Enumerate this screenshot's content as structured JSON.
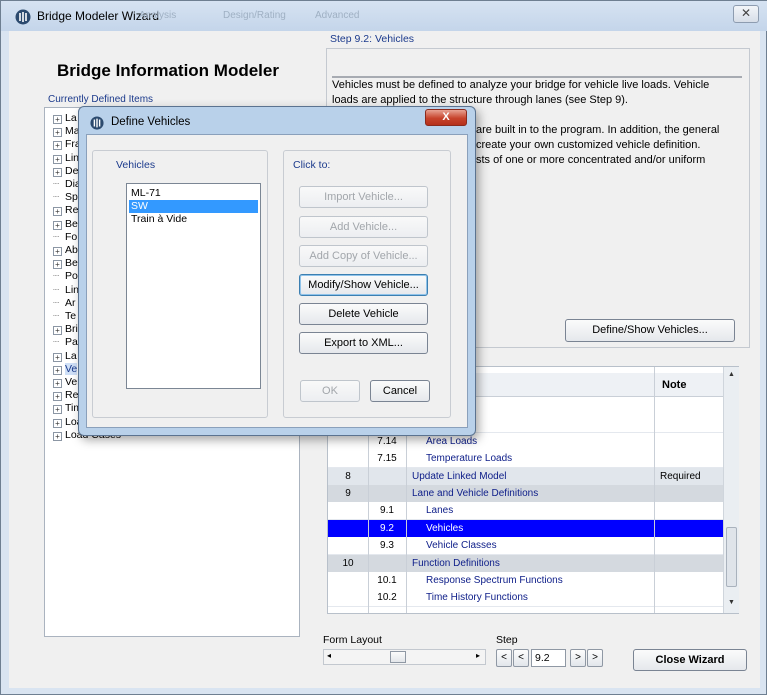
{
  "window": {
    "title": "Bridge Modeler Wizard",
    "ghost_menu": [
      "Analysis",
      "Design/Rating",
      "Advanced"
    ],
    "close_glyph": "✕"
  },
  "left_panel": {
    "title": "Bridge Information Modeler",
    "current_label": "Currently Defined Items",
    "tree": [
      {
        "label": "La",
        "expandable": true
      },
      {
        "label": "Ma",
        "expandable": true
      },
      {
        "label": "Fra",
        "expandable": true
      },
      {
        "label": "Lin",
        "expandable": true
      },
      {
        "label": "De",
        "expandable": true
      },
      {
        "label": "Dia",
        "expandable": false
      },
      {
        "label": "Sp",
        "expandable": false
      },
      {
        "label": "Re",
        "expandable": true
      },
      {
        "label": "Be",
        "expandable": true
      },
      {
        "label": "Fo",
        "expandable": false
      },
      {
        "label": "Ab",
        "expandable": true
      },
      {
        "label": "Be",
        "expandable": true
      },
      {
        "label": "Po",
        "expandable": false
      },
      {
        "label": "Lin",
        "expandable": false
      },
      {
        "label": "Ar",
        "expandable": false
      },
      {
        "label": "Te",
        "expandable": false
      },
      {
        "label": "Bri",
        "expandable": true
      },
      {
        "label": "Pa",
        "expandable": false
      },
      {
        "label": "La",
        "expandable": true
      },
      {
        "label": "Ve",
        "expandable": true,
        "highlight": true
      },
      {
        "label": "Vehicle Classes",
        "expandable": true
      },
      {
        "label": "Response Spectrum Functions",
        "expandable": true
      },
      {
        "label": "Time History Functions",
        "expandable": true
      },
      {
        "label": "Load Patterns",
        "expandable": true
      },
      {
        "label": "Load Cases",
        "expandable": true
      }
    ]
  },
  "step_panel": {
    "label": "Step  9.2:  Vehicles",
    "lines": [
      "Vehicles must be defined to analyze your bridge for vehicle live loads. Vehicle",
      "loads are applied to the structure through lanes (see Step 9).",
      "",
      "are built in to the program. In addition, the general",
      "create your own customized vehicle definition.",
      "sts of one or more concentrated and/or uniform"
    ],
    "define_button": "Define/Show Vehicles..."
  },
  "table": {
    "header_note": "Note",
    "rows": [
      {
        "c1": "",
        "c2": "",
        "c3": "",
        "c4": "",
        "style": "blank"
      },
      {
        "c1": "",
        "c2": "",
        "c3": "",
        "c4": "",
        "style": "blank"
      },
      {
        "c1": "",
        "c2": "7.14",
        "c3": "Area Loads",
        "c4": "",
        "style": "sub"
      },
      {
        "c1": "",
        "c2": "7.15",
        "c3": "Temperature Loads",
        "c4": "",
        "style": "sub"
      },
      {
        "c1": "8",
        "c2": "",
        "c3": "Update Linked Model",
        "c4": "Required",
        "style": "main"
      },
      {
        "c1": "9",
        "c2": "",
        "c3": "Lane and Vehicle Definitions",
        "c4": "",
        "style": "group"
      },
      {
        "c1": "",
        "c2": "9.1",
        "c3": "Lanes",
        "c4": "",
        "style": "sub"
      },
      {
        "c1": "",
        "c2": "9.2",
        "c3": "Vehicles",
        "c4": "",
        "style": "selected"
      },
      {
        "c1": "",
        "c2": "9.3",
        "c3": "Vehicle Classes",
        "c4": "",
        "style": "sub"
      },
      {
        "c1": "10",
        "c2": "",
        "c3": "Function Definitions",
        "c4": "",
        "style": "group"
      },
      {
        "c1": "",
        "c2": "10.1",
        "c3": "Response Spectrum Functions",
        "c4": "",
        "style": "sub"
      },
      {
        "c1": "",
        "c2": "10.2",
        "c3": "Time History Functions",
        "c4": "",
        "style": "sub"
      }
    ]
  },
  "bottom": {
    "form_layout_label": "Form Layout",
    "step_label": "Step",
    "step_value": "9.2",
    "close_wizard": "Close Wizard"
  },
  "dialog": {
    "title": "Define Vehicles",
    "close_glyph": "X",
    "vehicles_label": "Vehicles",
    "vehicles": [
      "ML-71",
      "SW",
      "Train à Vide"
    ],
    "selected_index": 1,
    "click_to_label": "Click to:",
    "buttons": {
      "import": "Import Vehicle...",
      "add": "Add Vehicle...",
      "add_copy": "Add Copy of Vehicle...",
      "modify": "Modify/Show Vehicle...",
      "delete": "Delete Vehicle",
      "export": "Export to XML...",
      "ok": "OK",
      "cancel": "Cancel"
    }
  },
  "colors": {
    "selection": "#0000ff",
    "group_row": "#d4d9df",
    "main_row": "#e1e6ec",
    "list_selection": "#3399ff",
    "label_blue": "#1b3a8c"
  }
}
